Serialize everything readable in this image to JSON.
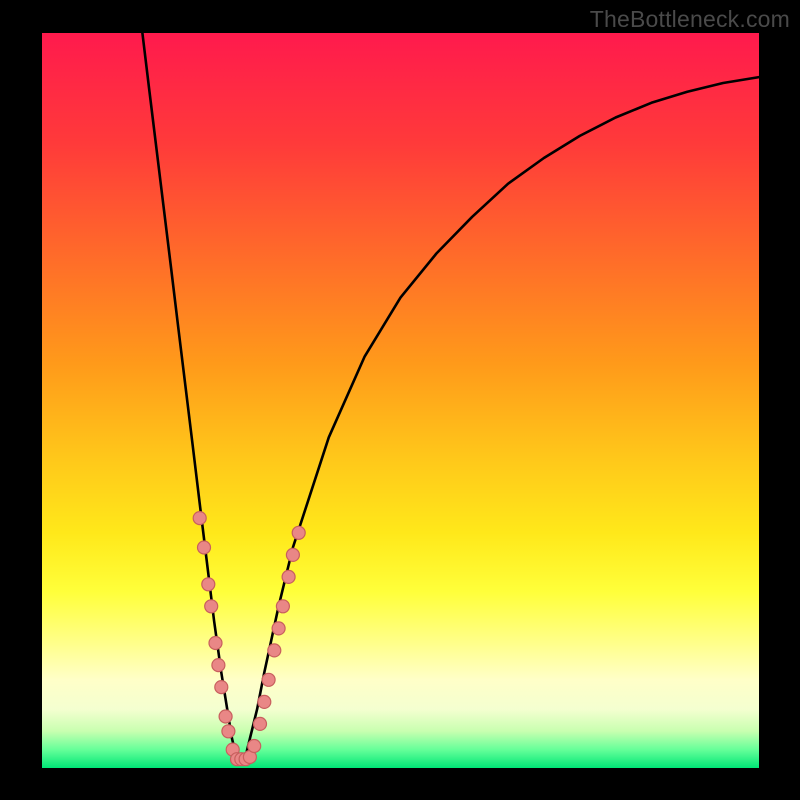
{
  "watermark": "TheBottleneck.com",
  "colors": {
    "gradient_top": "#ff1a4d",
    "gradient_bottom": "#00e676",
    "curve": "#000000",
    "dot_fill": "#e98786",
    "dot_stroke": "#c85f5e",
    "frame": "#000000"
  },
  "chart_data": {
    "type": "line",
    "title": "",
    "xlabel": "",
    "ylabel": "",
    "xlim": [
      0,
      100
    ],
    "ylim": [
      0,
      100
    ],
    "grid": false,
    "legend": false,
    "series": [
      {
        "name": "bottleneck-curve",
        "x": [
          14,
          15,
          16,
          17,
          18,
          19,
          20,
          21,
          22,
          23,
          24,
          25,
          26,
          26.5,
          27,
          27.5,
          28,
          28.5,
          29,
          30,
          31,
          33,
          35,
          40,
          45,
          50,
          55,
          60,
          65,
          70,
          75,
          80,
          85,
          90,
          95,
          100
        ],
        "y": [
          100,
          92,
          84,
          76,
          68,
          60,
          52,
          44,
          36,
          28,
          20,
          13,
          7,
          4,
          2,
          1,
          1,
          2,
          4,
          8,
          13,
          22,
          30,
          45,
          56,
          64,
          70,
          75,
          79.5,
          83,
          86,
          88.5,
          90.5,
          92,
          93.2,
          94
        ]
      }
    ],
    "dots": [
      {
        "x": 22.0,
        "y": 34
      },
      {
        "x": 22.6,
        "y": 30
      },
      {
        "x": 23.2,
        "y": 25
      },
      {
        "x": 23.6,
        "y": 22
      },
      {
        "x": 24.2,
        "y": 17
      },
      {
        "x": 24.6,
        "y": 14
      },
      {
        "x": 25.0,
        "y": 11
      },
      {
        "x": 25.6,
        "y": 7
      },
      {
        "x": 26.0,
        "y": 5
      },
      {
        "x": 26.6,
        "y": 2.5
      },
      {
        "x": 27.2,
        "y": 1.2
      },
      {
        "x": 27.8,
        "y": 1.2
      },
      {
        "x": 28.4,
        "y": 1.2
      },
      {
        "x": 29.0,
        "y": 1.5
      },
      {
        "x": 29.6,
        "y": 3
      },
      {
        "x": 30.4,
        "y": 6
      },
      {
        "x": 31.0,
        "y": 9
      },
      {
        "x": 31.6,
        "y": 12
      },
      {
        "x": 32.4,
        "y": 16
      },
      {
        "x": 33.0,
        "y": 19
      },
      {
        "x": 33.6,
        "y": 22
      },
      {
        "x": 34.4,
        "y": 26
      },
      {
        "x": 35.0,
        "y": 29
      },
      {
        "x": 35.8,
        "y": 32
      }
    ]
  }
}
